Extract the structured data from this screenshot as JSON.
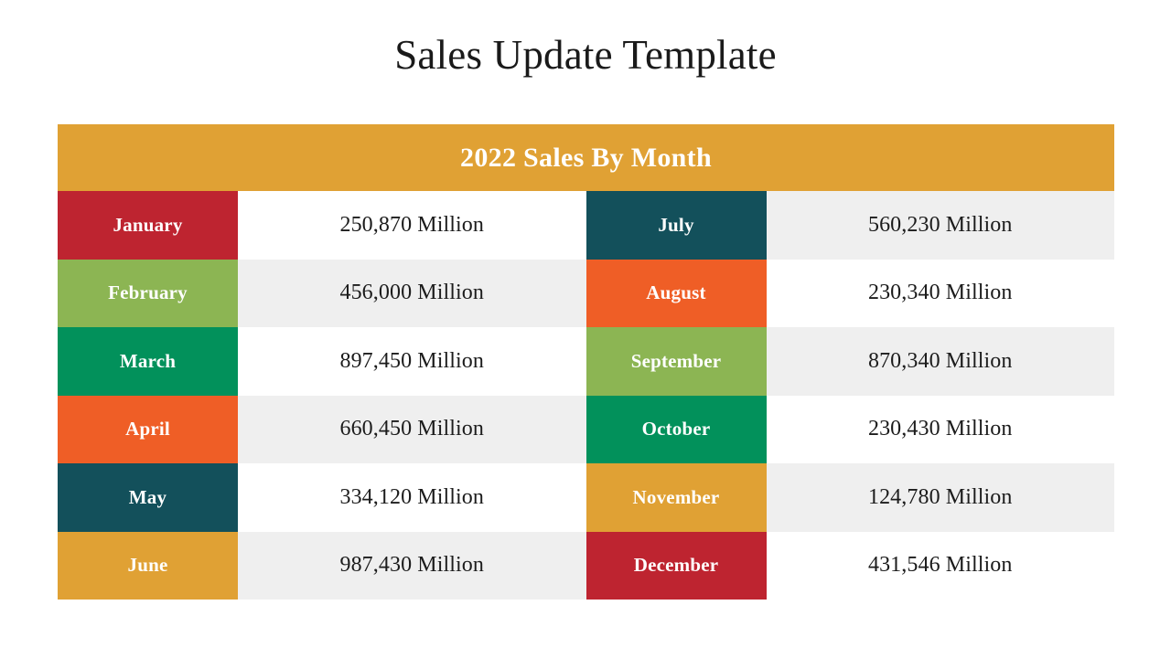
{
  "slide": {
    "title": "Sales Update Template",
    "background_color": "#FFFFFF"
  },
  "table": {
    "header_title": "2022 Sales By Month",
    "header_bg": "#E0A134",
    "header_text_color": "#FFFFFF",
    "row_bg_white": "#FFFFFF",
    "row_bg_gray": "#EFEFEF",
    "palette": {
      "red": "#BE2430",
      "light_green": "#8CB553",
      "emerald": "#02915B",
      "orange": "#EF5E26",
      "teal": "#13505B",
      "amber": "#E0A134"
    },
    "rows": [
      {
        "left": {
          "month": "January",
          "value": "250,870 Million",
          "month_bg": "#BE2430",
          "value_bg": "#FFFFFF"
        },
        "right": {
          "month": "July",
          "value": "560,230  Million",
          "month_bg": "#13505B",
          "value_bg": "#EFEFEF"
        }
      },
      {
        "left": {
          "month": "February",
          "value": "456,000 Million",
          "month_bg": "#8CB553",
          "value_bg": "#EFEFEF"
        },
        "right": {
          "month": "August",
          "value": "230,340  Million",
          "month_bg": "#EF5E26",
          "value_bg": "#FFFFFF"
        }
      },
      {
        "left": {
          "month": "March",
          "value": "897,450 Million",
          "month_bg": "#02915B",
          "value_bg": "#FFFFFF"
        },
        "right": {
          "month": "September",
          "value": "870,340  Million",
          "month_bg": "#8CB553",
          "value_bg": "#EFEFEF"
        }
      },
      {
        "left": {
          "month": "April",
          "value": "660,450 Million",
          "month_bg": "#EF5E26",
          "value_bg": "#EFEFEF"
        },
        "right": {
          "month": "October",
          "value": "230,430 Million",
          "month_bg": "#02915B",
          "value_bg": "#FFFFFF"
        }
      },
      {
        "left": {
          "month": "May",
          "value": "334,120 Million",
          "month_bg": "#13505B",
          "value_bg": "#FFFFFF"
        },
        "right": {
          "month": "November",
          "value": "124,780 Million",
          "month_bg": "#E0A134",
          "value_bg": "#EFEFEF"
        }
      },
      {
        "left": {
          "month": "June",
          "value": "987,430 Million",
          "month_bg": "#E0A134",
          "value_bg": "#EFEFEF"
        },
        "right": {
          "month": "December",
          "value": "431,546 Million",
          "month_bg": "#BE2430",
          "value_bg": "#FFFFFF"
        }
      }
    ]
  }
}
